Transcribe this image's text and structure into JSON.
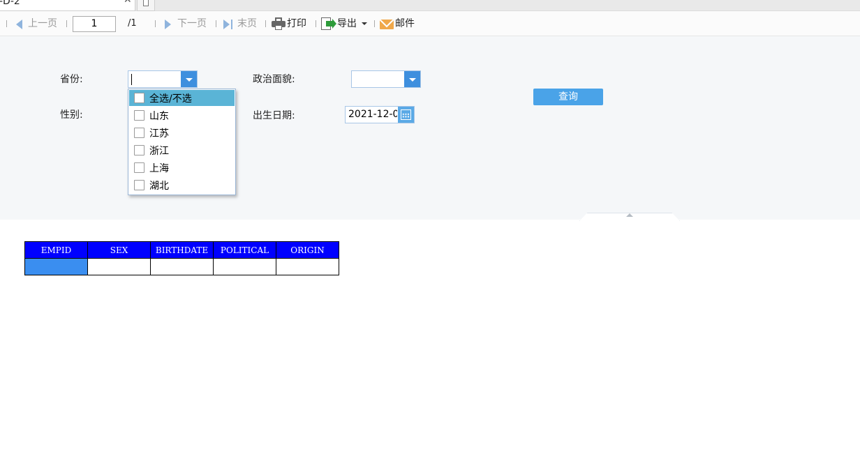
{
  "tab": {
    "title": "-D-2",
    "close_icon": "close-icon",
    "new_tab_icon": "new-tab-icon"
  },
  "toolbar": {
    "prev_label": "上一页",
    "page_value": "1",
    "page_total": "/1",
    "next_label": "下一页",
    "last_label": "末页",
    "print_label": "打印",
    "export_label": "导出",
    "mail_label": "邮件"
  },
  "params": {
    "province_label": "省份:",
    "political_label": "政治面貌:",
    "sex_label": "性别:",
    "birthdate_label": "出生日期:",
    "birthdate_value": "2021-12-0",
    "query_label": "查询"
  },
  "province_dropdown": {
    "items": [
      {
        "label": "全选/不选",
        "checked": false,
        "highlighted": true
      },
      {
        "label": "山东",
        "checked": false
      },
      {
        "label": "江苏",
        "checked": false
      },
      {
        "label": "浙江",
        "checked": false
      },
      {
        "label": "上海",
        "checked": false
      },
      {
        "label": "湖北",
        "checked": false
      }
    ]
  },
  "table": {
    "columns": [
      "EMPID",
      "SEX",
      "BIRTHDATE",
      "POLITICAL",
      "ORIGIN"
    ],
    "rows": [
      [
        "",
        "",
        "",
        "",
        ""
      ]
    ]
  },
  "colors": {
    "header_bg": "#0000ff",
    "selected_cell": "#3a8ef0",
    "query_button": "#4aa3e8",
    "dropdown_highlight": "#5ab4d6"
  }
}
